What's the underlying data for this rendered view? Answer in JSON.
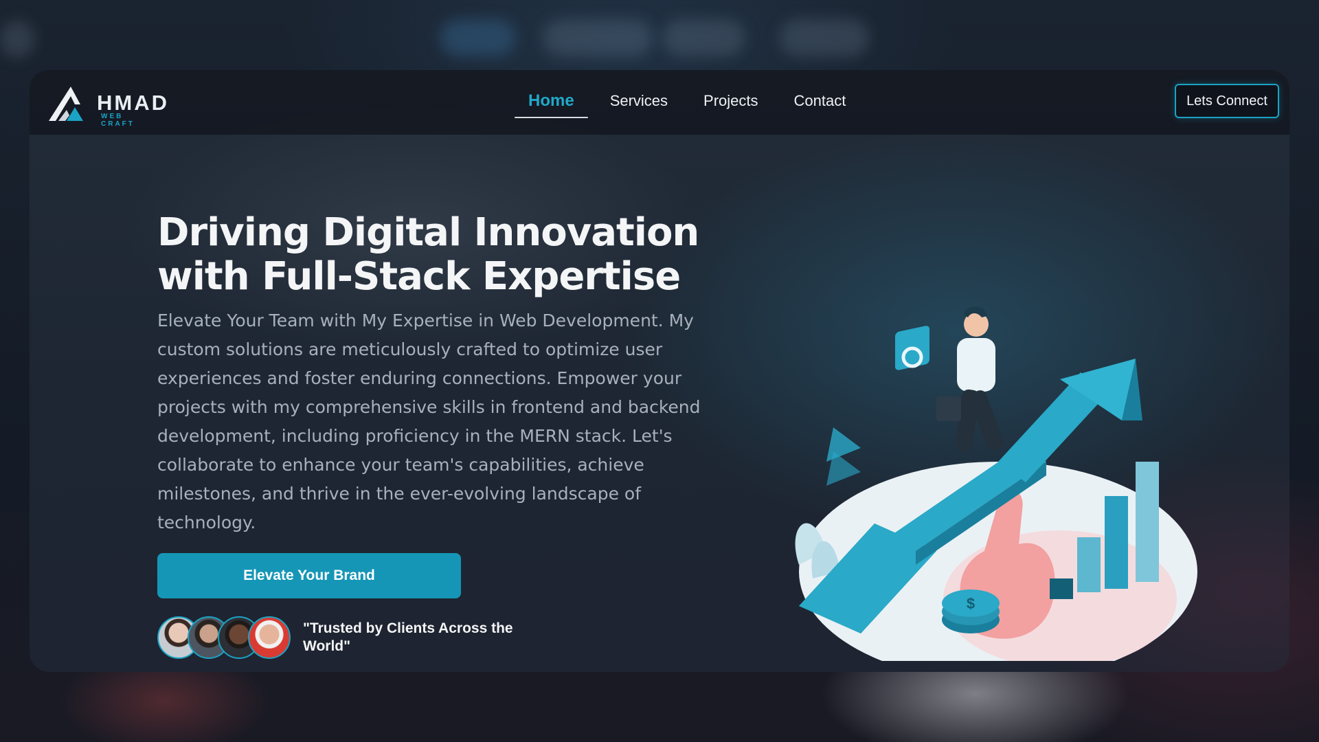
{
  "brand": {
    "logo_text": "HMAD",
    "logo_subtext": "WEB CRAFT",
    "accent_color": "#1ba3c4"
  },
  "nav": {
    "items": [
      {
        "label": "Home",
        "active": true
      },
      {
        "label": "Services",
        "active": false
      },
      {
        "label": "Projects",
        "active": false
      },
      {
        "label": "Contact",
        "active": false
      }
    ],
    "cta_label": "Lets Connect"
  },
  "hero": {
    "title_line1": "Driving Digital Innovation",
    "title_line2": "with Full-Stack Expertise",
    "description": "Elevate Your Team with My Expertise in Web Development. My custom solutions are meticulously crafted to optimize user experiences and foster enduring connections. Empower your projects with my comprehensive skills in frontend and backend development, including proficiency in the MERN stack. Let's collaborate to enhance your team's capabilities, achieve milestones, and thrive in the ever-evolving landscape of technology.",
    "cta_label": "Elevate Your Brand",
    "trust_text": "\"Trusted by Clients Across the World\""
  },
  "icons": [
    "logo-mark-icon",
    "gear-icon",
    "avatar",
    "growth-arrow-illustration"
  ]
}
